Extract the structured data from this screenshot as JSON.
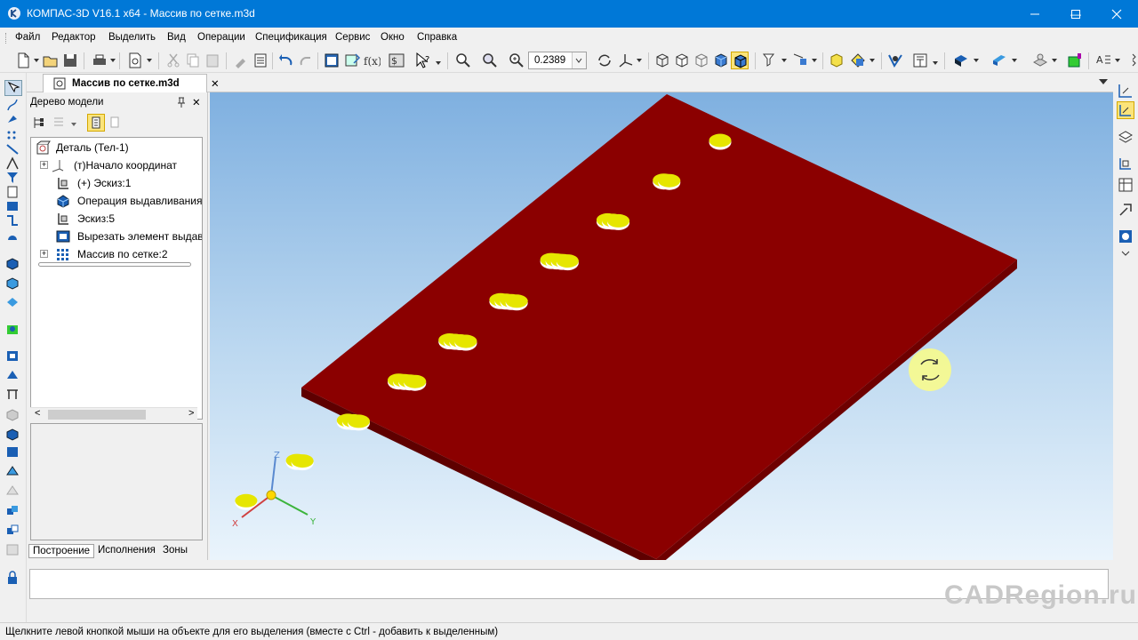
{
  "window": {
    "title": "КОМПАС-3D V16.1 x64 - Массив по сетке.m3d",
    "minimize_glyph": "—",
    "maximize_glyph": "☐",
    "close_glyph": "✕"
  },
  "menu": [
    "Файл",
    "Редактор",
    "Выделить",
    "Вид",
    "Операции",
    "Спецификация",
    "Сервис",
    "Окно",
    "Справка"
  ],
  "toolbar": {
    "zoom_value": "0.2389"
  },
  "document_tab": {
    "label": "Массив по сетке.m3d",
    "close_glyph": "✕"
  },
  "tree_panel": {
    "title": "Дерево модели",
    "pin_glyph": "ᵖ",
    "close_glyph": "✕",
    "items": [
      {
        "label": "Деталь (Тел-1)",
        "icon": "part-icon"
      },
      {
        "label": "(т)Начало координат",
        "icon": "origin-icon"
      },
      {
        "label": "(+) Эскиз:1",
        "icon": "sketch-icon"
      },
      {
        "label": "Операция выдавливания",
        "icon": "extrude-icon"
      },
      {
        "label": "Эскиз:5",
        "icon": "sketch-icon"
      },
      {
        "label": "Вырезать элемент выдав.",
        "icon": "cut-extrude-icon"
      },
      {
        "label": "Массив по сетке:2",
        "icon": "grid-array-icon"
      }
    ],
    "tabs": [
      "Построение",
      "Исполнения",
      "Зоны"
    ],
    "scroll_left": "<",
    "scroll_right": ">"
  },
  "viewport": {
    "triad": {
      "x": "X",
      "y": "Y",
      "z": "Z"
    },
    "plate_color": "#8b0000",
    "hole_color": "#e6e600",
    "background_top": "#7fb0e0",
    "background_bottom": "#eaf4fc"
  },
  "watermark": "CADRegion.ru",
  "status": {
    "message": "Щелкните левой кнопкой мыши на объекте для его выделения (вместе с Ctrl - добавить к выделенным)"
  }
}
